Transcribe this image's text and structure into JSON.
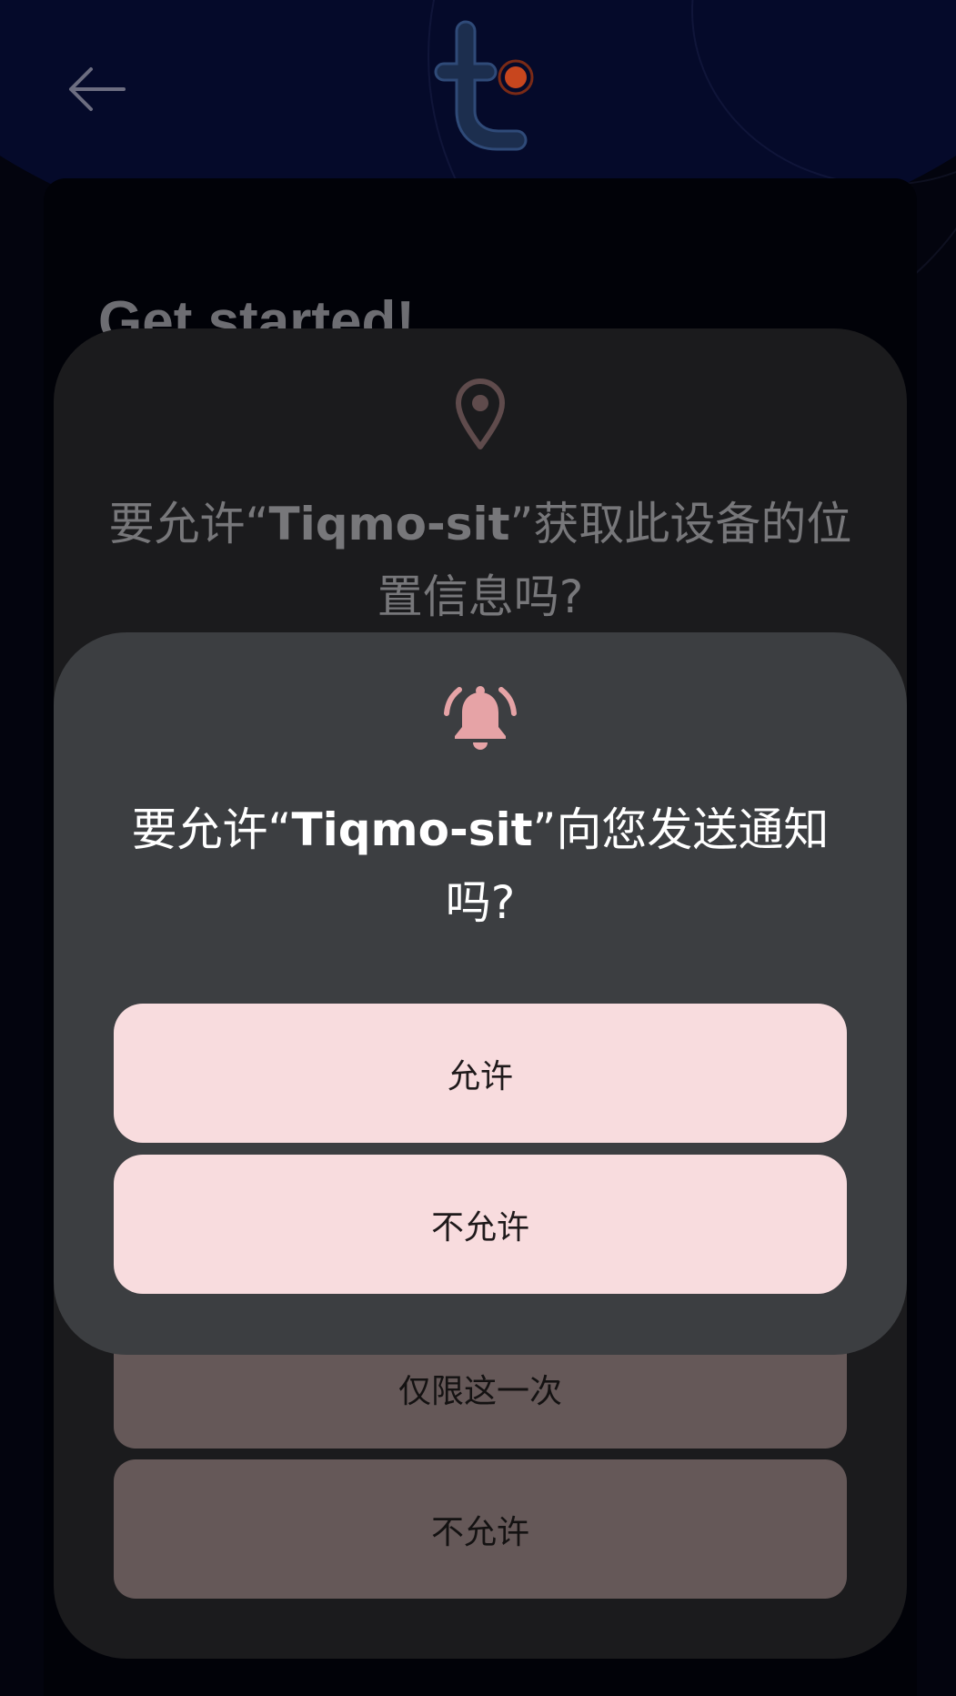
{
  "app": {
    "heading": "Get started!",
    "back_icon": "arrow-left-icon",
    "logo_icon": "tiqmo-logo-icon"
  },
  "location_dialog": {
    "icon": "location-pin-icon",
    "title_prefix": "要允许“",
    "app_name": "Tiqmo-sit",
    "title_suffix": "”获取此设备的位置信息吗?",
    "options": {
      "only_this_time": "仅限这一次",
      "deny": "不允许"
    }
  },
  "notification_dialog": {
    "icon": "bell-ringing-icon",
    "title_prefix": "要允许“",
    "app_name": "Tiqmo-sit",
    "title_suffix": "”向您发送通知吗?",
    "options": {
      "allow": "允许",
      "deny": "不允许"
    }
  },
  "colors": {
    "background": "#03040e",
    "hero": "#050a2a",
    "location_dialog": "#1b1b1d",
    "notification_dialog": "#3c3e41",
    "button_primary": "#f8dcde",
    "button_dimmed": "#655858",
    "accent_bell": "#e6a3a6",
    "logo_accent": "#c8461e"
  }
}
